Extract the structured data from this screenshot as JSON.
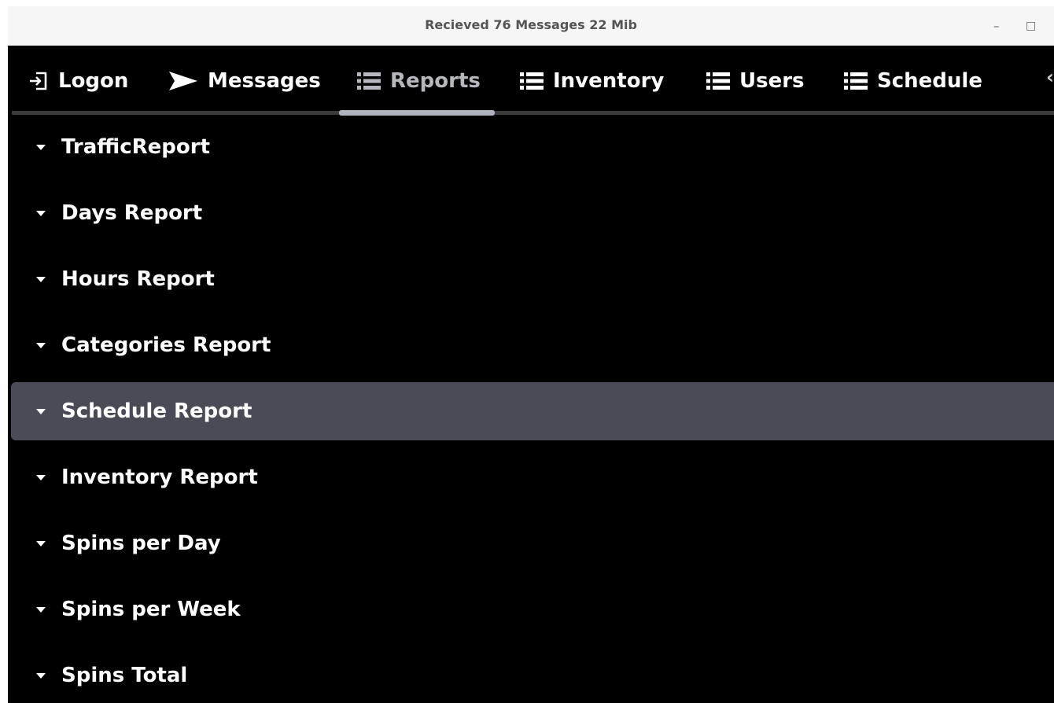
{
  "window": {
    "title": "Recieved 76 Messages  22 Mib",
    "minimize_glyph": "–",
    "maximize_glyph": "□"
  },
  "tabs": [
    {
      "label": "Logon",
      "icon": "logon-arrow-icon"
    },
    {
      "label": "Messages",
      "icon": "send-icon"
    },
    {
      "label": "Reports",
      "icon": "list-icon",
      "active": true
    },
    {
      "label": "Inventory",
      "icon": "list-icon"
    },
    {
      "label": "Users",
      "icon": "list-icon"
    },
    {
      "label": "Schedule",
      "icon": "list-icon"
    }
  ],
  "tab_overflow_glyph": "‹",
  "reports": {
    "items": [
      {
        "label": "TrafficReport",
        "expanded": true
      },
      {
        "label": "Days Report",
        "expanded": true
      },
      {
        "label": "Hours Report",
        "expanded": true
      },
      {
        "label": "Categories Report",
        "expanded": true
      },
      {
        "label": "Schedule Report",
        "expanded": true,
        "selected": true
      },
      {
        "label": "Inventory Report",
        "expanded": true
      },
      {
        "label": "Spins per Day",
        "expanded": true
      },
      {
        "label": "Spins per Week",
        "expanded": true
      },
      {
        "label": "Spins Total",
        "expanded": true
      }
    ]
  },
  "colors": {
    "background": "#000000",
    "titlebar": "#f6f6f6",
    "selected_row": "#4a4b57",
    "active_tab_text": "#b7b8bf",
    "tab_indicator": "#b0b3bd"
  }
}
